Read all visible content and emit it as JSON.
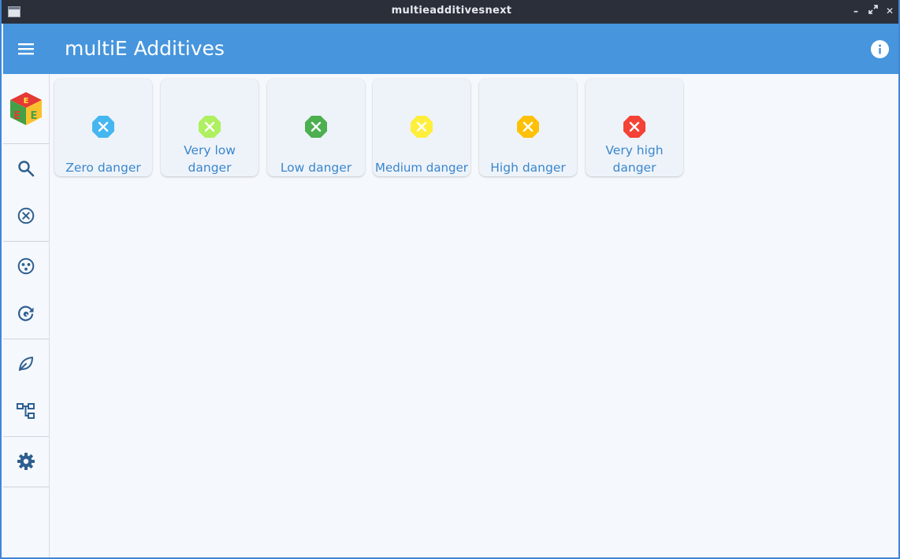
{
  "window": {
    "title": "multieadditivesnext"
  },
  "appbar": {
    "title": "multiE Additives"
  },
  "colors": {
    "primary": "#4695dd",
    "label": "#3a86cc",
    "icon": "#2f5f8f"
  },
  "sidebar": {
    "items": [
      {
        "name": "app-logo",
        "icon": "cube-logo-icon"
      },
      {
        "name": "search",
        "icon": "search-icon"
      },
      {
        "name": "dangers",
        "icon": "cancel-circle-icon"
      },
      {
        "name": "groups",
        "icon": "dots-circle-icon"
      },
      {
        "name": "refresh",
        "icon": "refresh-circle-icon"
      },
      {
        "name": "vegetarian",
        "icon": "leaf-icon"
      },
      {
        "name": "categories",
        "icon": "tree-icon"
      },
      {
        "name": "settings",
        "icon": "gear-icon"
      }
    ]
  },
  "dangers": [
    {
      "label": "Zero danger",
      "color": "#45b6f0"
    },
    {
      "label": "Very low danger",
      "color": "#aef060"
    },
    {
      "label": "Low danger",
      "color": "#4caf50"
    },
    {
      "label": "Medium danger",
      "color": "#ffee3a"
    },
    {
      "label": "High danger",
      "color": "#ffc107"
    },
    {
      "label": "Very high danger",
      "color": "#f44336"
    }
  ]
}
